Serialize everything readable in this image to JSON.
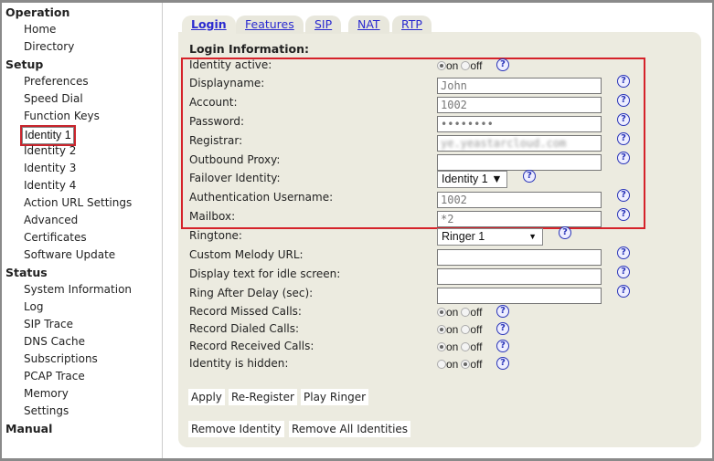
{
  "sidebar": {
    "items": [
      {
        "label": "Operation",
        "type": "header"
      },
      {
        "label": "Home"
      },
      {
        "label": "Directory"
      },
      {
        "label": "Setup",
        "type": "header"
      },
      {
        "label": "Preferences"
      },
      {
        "label": "Speed Dial"
      },
      {
        "label": "Function Keys"
      },
      {
        "label": "Identity 1",
        "selected": true
      },
      {
        "label": "Identity 2"
      },
      {
        "label": "Identity 3"
      },
      {
        "label": "Identity 4"
      },
      {
        "label": "Action URL Settings"
      },
      {
        "label": "Advanced"
      },
      {
        "label": "Certificates"
      },
      {
        "label": "Software Update"
      },
      {
        "label": "Status",
        "type": "header"
      },
      {
        "label": "System Information"
      },
      {
        "label": "Log"
      },
      {
        "label": "SIP Trace"
      },
      {
        "label": "DNS Cache"
      },
      {
        "label": "Subscriptions"
      },
      {
        "label": "PCAP Trace"
      },
      {
        "label": "Memory"
      },
      {
        "label": "Settings"
      },
      {
        "label": "Manual",
        "type": "header"
      }
    ]
  },
  "tabs": [
    {
      "label": "Login",
      "active": true
    },
    {
      "label": "Features"
    },
    {
      "label": "SIP"
    },
    {
      "label": "NAT"
    },
    {
      "label": "RTP"
    }
  ],
  "section_title": "Login Information:",
  "radio_labels": {
    "on": "on",
    "off": "off"
  },
  "help_glyph": "?",
  "fields": [
    {
      "label": "Identity active:",
      "type": "radio",
      "value": "on"
    },
    {
      "label": "Displayname:",
      "type": "text",
      "value": "John"
    },
    {
      "label": "Account:",
      "type": "text",
      "value": "1002"
    },
    {
      "label": "Password:",
      "type": "password",
      "value": "••••••••"
    },
    {
      "label": "Registrar:",
      "type": "text",
      "value": "ye.yeastarcloud.com",
      "blurred": true
    },
    {
      "label": "Outbound Proxy:",
      "type": "text",
      "value": ""
    },
    {
      "label": "Failover Identity:",
      "type": "select",
      "value": "Identity 1 ▼"
    },
    {
      "label": "Authentication Username:",
      "type": "text",
      "value": "1002"
    },
    {
      "label": "Mailbox:",
      "type": "text",
      "value": "*2"
    },
    {
      "label": "Ringtone:",
      "type": "select",
      "value": "Ringer 1"
    },
    {
      "label": "Custom Melody URL:",
      "type": "text",
      "value": ""
    },
    {
      "label": "Display text for idle screen:",
      "type": "text",
      "value": ""
    },
    {
      "label": "Ring After Delay (sec):",
      "type": "text",
      "value": ""
    },
    {
      "label": "Record Missed Calls:",
      "type": "radio",
      "value": "on"
    },
    {
      "label": "Record Dialed Calls:",
      "type": "radio",
      "value": "on"
    },
    {
      "label": "Record Received Calls:",
      "type": "radio",
      "value": "on"
    },
    {
      "label": "Identity is hidden:",
      "type": "radio",
      "value": "off"
    }
  ],
  "buttons": {
    "apply": "Apply",
    "reregister": "Re-Register",
    "play_ringer": "Play Ringer",
    "remove_identity": "Remove Identity",
    "remove_all": "Remove All Identities"
  },
  "colors": {
    "highlight": "#d5222a",
    "panel": "#ecebe0",
    "link": "#2a2ad0"
  }
}
